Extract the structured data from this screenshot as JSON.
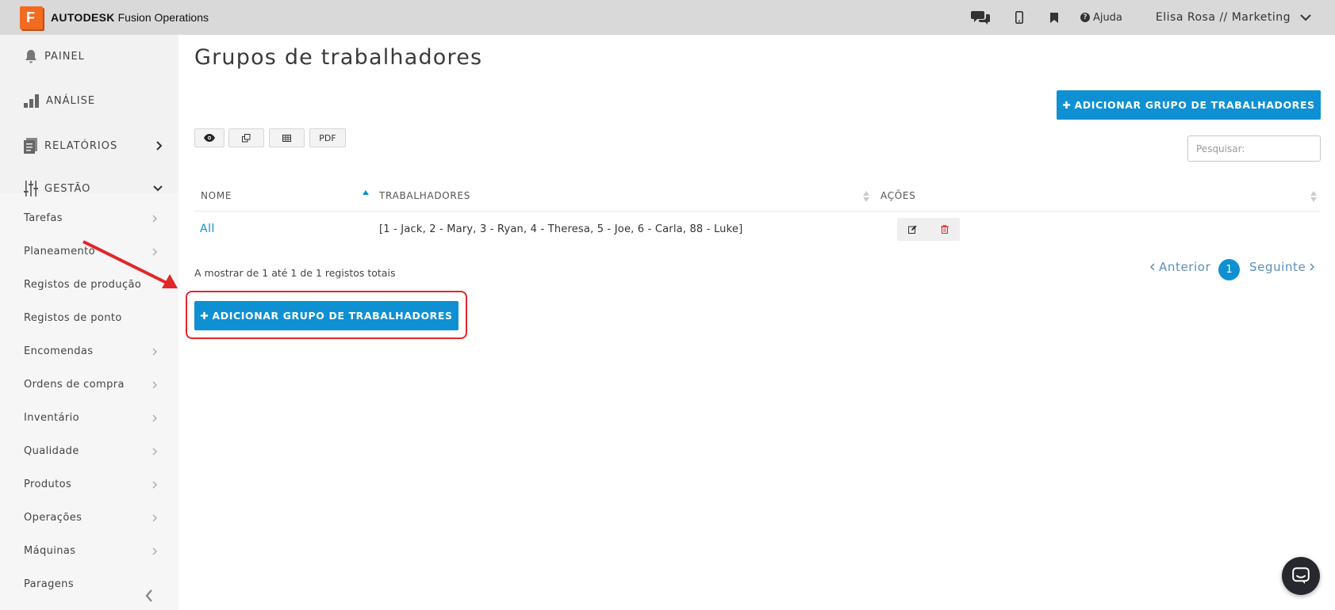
{
  "header": {
    "logo_letter": "F",
    "brand_bold": "AUTODESK",
    "brand_rest": "Fusion Operations",
    "help_label": "Ajuda",
    "user_label": "Elisa Rosa // Marketing"
  },
  "sidebar": {
    "main_items": [
      {
        "label": "PAINEL",
        "icon": "bell-icon"
      },
      {
        "label": "ANÁLISE",
        "icon": "bar-chart-icon"
      },
      {
        "label": "RELATÓRIOS",
        "icon": "report-icon"
      },
      {
        "label": "GESTÃO",
        "icon": "sliders-icon"
      }
    ],
    "sub_items": [
      {
        "label": "Tarefas",
        "has_arrow": true
      },
      {
        "label": "Planeamento",
        "has_arrow": true
      },
      {
        "label": "Registos de produção",
        "has_arrow": false
      },
      {
        "label": "Registos de ponto",
        "has_arrow": false
      },
      {
        "label": "Encomendas",
        "has_arrow": true
      },
      {
        "label": "Ordens de compra",
        "has_arrow": true
      },
      {
        "label": "Inventário",
        "has_arrow": true
      },
      {
        "label": "Qualidade",
        "has_arrow": true
      },
      {
        "label": "Produtos",
        "has_arrow": true
      },
      {
        "label": "Operações",
        "has_arrow": true
      },
      {
        "label": "Máquinas",
        "has_arrow": true
      },
      {
        "label": "Paragens",
        "has_arrow": false
      }
    ]
  },
  "main": {
    "title": "Grupos de trabalhadores",
    "add_button_label": "ADICIONAR GRUPO DE TRABALHADORES",
    "toolbar": {
      "pdf_label": "PDF"
    },
    "search_placeholder": "Pesquisar:",
    "table": {
      "headers": [
        "NOME",
        "TRABALHADORES",
        "AÇÕES"
      ],
      "rows": [
        {
          "name": "All",
          "workers": "[1 - Jack, 2 - Mary, 3 - Ryan, 4 - Theresa, 5 - Joe, 6 - Carla, 88 - Luke]"
        }
      ]
    },
    "info_text": "A mostrar de 1 até 1 de 1 registos totais",
    "pagination": {
      "prev": "Anterior",
      "current": "1",
      "next": "Seguinte"
    }
  },
  "colors": {
    "accent": "#0e90d2",
    "highlight": "#e3262a",
    "logo": "#f26b21"
  }
}
